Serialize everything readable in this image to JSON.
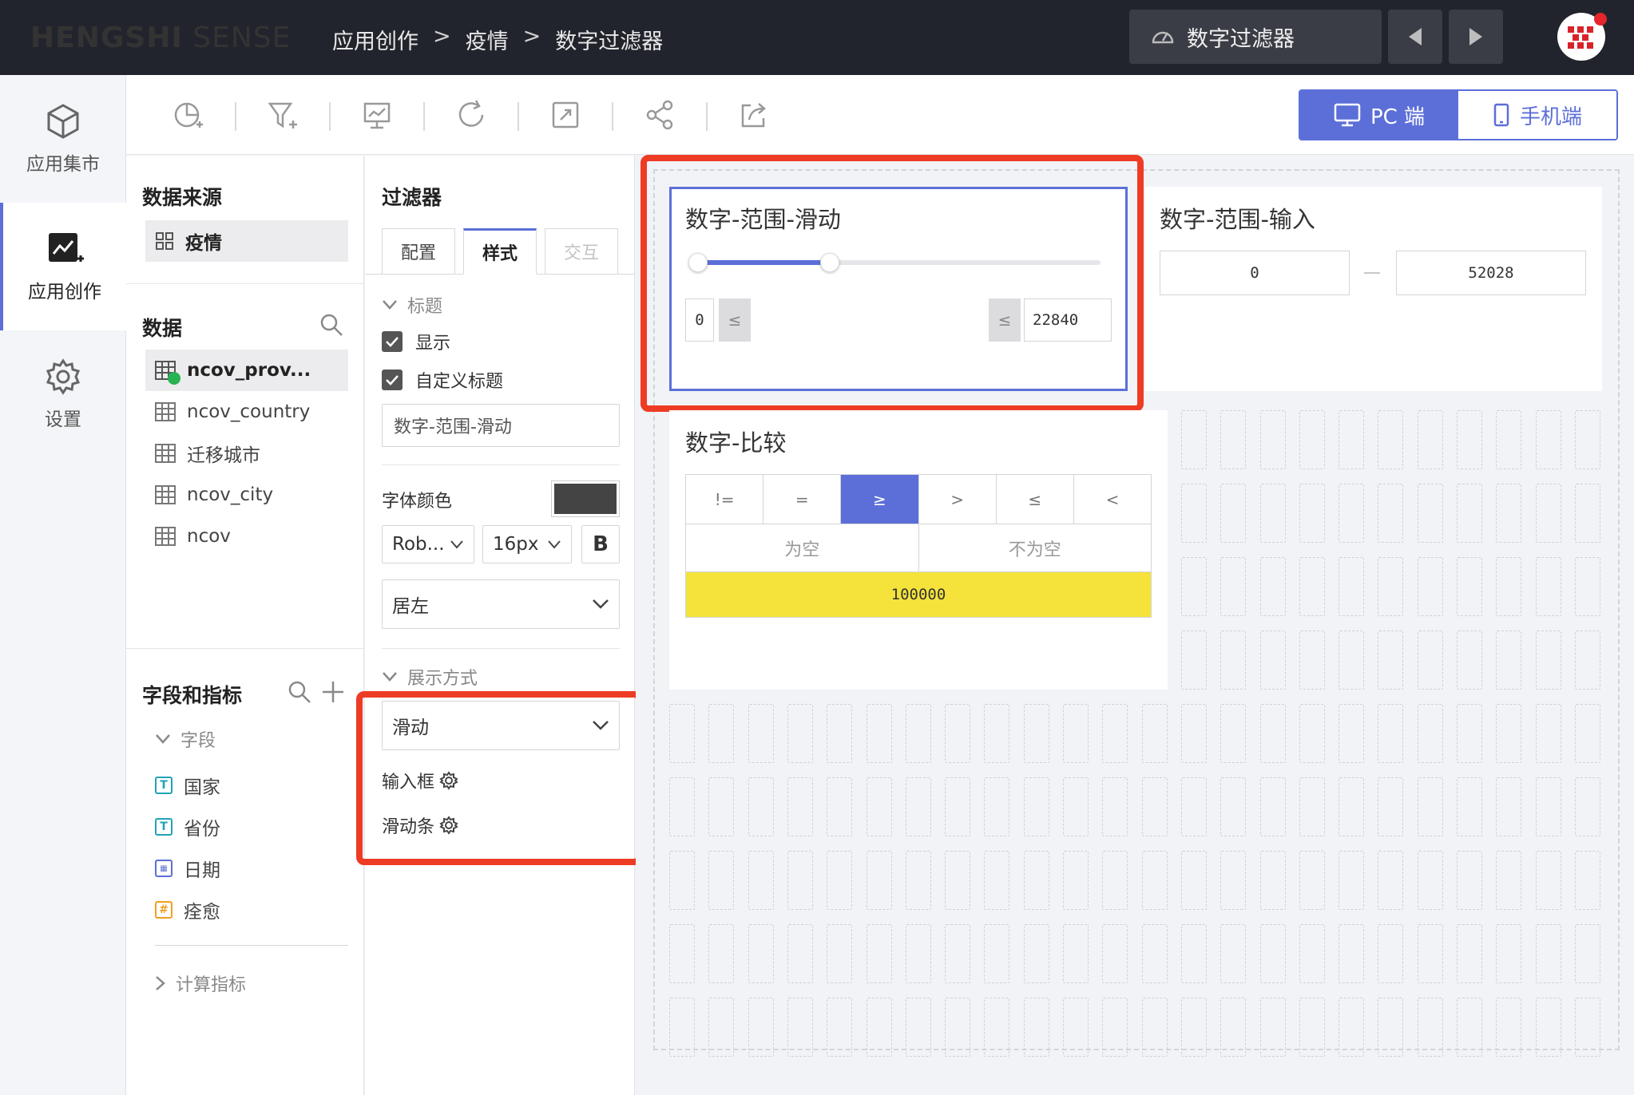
{
  "topbar": {
    "logo_bold": "HENGSHI",
    "logo_rest": " SENSE",
    "breadcrumb": [
      "应用创作",
      "疫情",
      "数字过滤器"
    ],
    "breadcrumb_sep": ">",
    "dashboard_select": "数字过滤器"
  },
  "leftnav": {
    "items": [
      {
        "label": "应用集市",
        "icon": "cube-icon"
      },
      {
        "label": "应用创作",
        "icon": "chart-create-icon"
      },
      {
        "label": "设置",
        "icon": "gear-icon"
      }
    ]
  },
  "toolbar": {
    "device_pc": "PC 端",
    "device_mobile": "手机端"
  },
  "datapanel": {
    "source_title": "数据来源",
    "source_item": "疫情",
    "data_title": "数据",
    "tables": [
      "ncov_prov...",
      "ncov_country",
      "迁移城市",
      "ncov_city",
      "ncov"
    ],
    "fields_title": "字段和指标",
    "fields_section": "字段",
    "fields": [
      {
        "label": "国家",
        "type": "T",
        "color": "#21a3b5"
      },
      {
        "label": "省份",
        "type": "T",
        "color": "#21a3b5"
      },
      {
        "label": "日期",
        "type": "cal",
        "color": "#5c6fd8"
      },
      {
        "label": "痊愈",
        "type": "#",
        "color": "#f0a020"
      }
    ],
    "calc_section": "计算指标"
  },
  "cfgpanel": {
    "title": "过滤器",
    "tabs": [
      "配置",
      "样式",
      "交互"
    ],
    "section_title": "标题",
    "show_label": "显示",
    "custom_title_label": "自定义标题",
    "custom_title_value": "数字-范围-滑动",
    "font_color_label": "字体颜色",
    "font_color": "#444444",
    "font_family": "Rob...",
    "font_size": "16px",
    "bold": "B",
    "align": "居左",
    "display_section": "展示方式",
    "display_mode": "滑动",
    "option_input": "输入框",
    "option_slider": "滑动条"
  },
  "canvas": {
    "slider_card": {
      "title": "数字-范围-滑动",
      "min_value": "0",
      "max_value": "22840",
      "le_symbol": "≤",
      "slider_fill_fraction": 0.33
    },
    "input_card": {
      "title": "数字-范围-输入",
      "min_value": "0",
      "max_value": "52028"
    },
    "compare_card": {
      "title": "数字-比较",
      "operators": [
        "!=",
        "=",
        "≥",
        ">",
        "≤",
        "<"
      ],
      "active_operator": "≥",
      "empty": "为空",
      "not_empty": "不为空",
      "value": "100000"
    }
  },
  "colors": {
    "accent": "#5c6fd8",
    "highlight": "#ee3b24",
    "value_yellow": "#f5e33b",
    "topbar": "#22242d"
  }
}
